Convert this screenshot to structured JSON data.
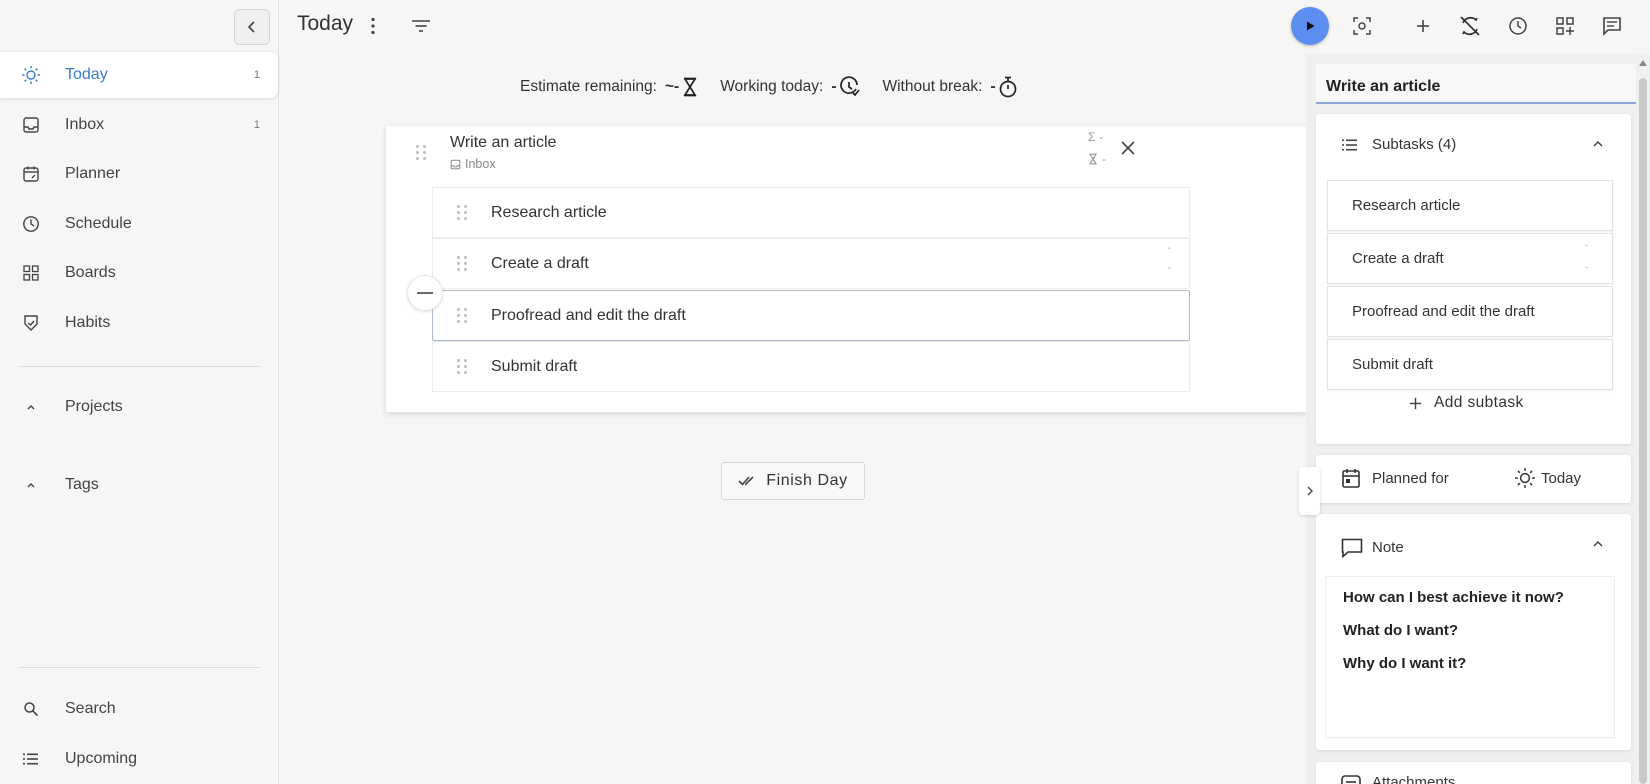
{
  "sidebar": {
    "items": [
      {
        "label": "Today",
        "count": "1",
        "icon": "sun-icon"
      },
      {
        "label": "Inbox",
        "count": "1",
        "icon": "inbox-icon"
      },
      {
        "label": "Planner",
        "icon": "planner-icon"
      },
      {
        "label": "Schedule",
        "icon": "clock-icon"
      },
      {
        "label": "Boards",
        "icon": "grid-icon"
      },
      {
        "label": "Habits",
        "icon": "habits-icon"
      }
    ],
    "sections": [
      {
        "label": "Projects",
        "icon": "chevron-up-icon"
      },
      {
        "label": "Tags",
        "icon": "chevron-up-icon"
      }
    ],
    "bottom": [
      {
        "label": "Search",
        "icon": "search-icon"
      },
      {
        "label": "Upcoming",
        "icon": "list-icon"
      }
    ]
  },
  "header": {
    "title": "Today"
  },
  "metrics": {
    "estimate_label": "Estimate remaining:",
    "estimate_value": "~-",
    "working_label": "Working today:",
    "working_value": "-",
    "without_break_label": "Without break:",
    "without_break_value": "-"
  },
  "task": {
    "title": "Write an article",
    "project": "Inbox",
    "sum_value": "-",
    "estimate_value": "-",
    "subtasks": [
      {
        "title": "Research article"
      },
      {
        "title": "Create a draft",
        "time": "-",
        "estimate": "-"
      },
      {
        "title": "Proofread and edit the draft"
      },
      {
        "title": "Submit draft"
      }
    ]
  },
  "finish_day_label": "Finish Day",
  "detail_panel": {
    "title": "Write an article",
    "subtasks_header": "Subtasks (4)",
    "subtasks": [
      "Research article",
      "Create a draft",
      "Proofread and edit the draft",
      "Submit draft"
    ],
    "create_draft_meta": [
      "-",
      "-"
    ],
    "add_subtask_label": "Add subtask",
    "planned_for_label": "Planned for",
    "planned_for_value": "Today",
    "note_label": "Note",
    "note_lines": [
      "How can I best achieve it now?",
      "What do I want?",
      "Why do I want it?"
    ],
    "attachments_label": "Attachments"
  },
  "colors": {
    "accent": "#3b7bd0",
    "play_button": "#5b8ef0",
    "background": "#f6f6f5"
  }
}
